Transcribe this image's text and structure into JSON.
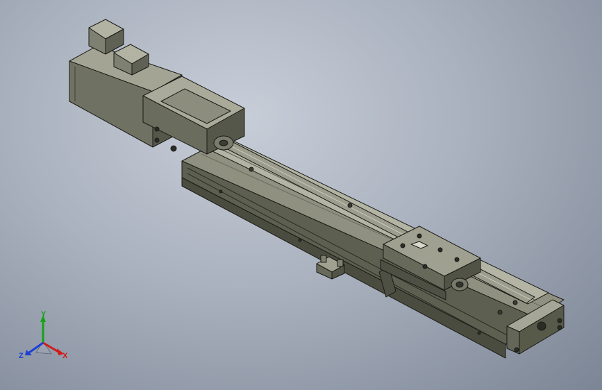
{
  "viewport": {
    "background_top": "#c8ced8",
    "background_bottom": "#7c8595"
  },
  "model": {
    "body_color": "#6e7061",
    "body_light": "#9a9b8a",
    "body_dark": "#3f4036",
    "edge_color": "#1a1a16",
    "rod_color": "#8d8e7f"
  },
  "triad": {
    "x_label": "X",
    "y_label": "Y",
    "z_label": "Z",
    "x_color": "#d11a1a",
    "y_color": "#16a316",
    "z_color": "#1c3fd6"
  }
}
